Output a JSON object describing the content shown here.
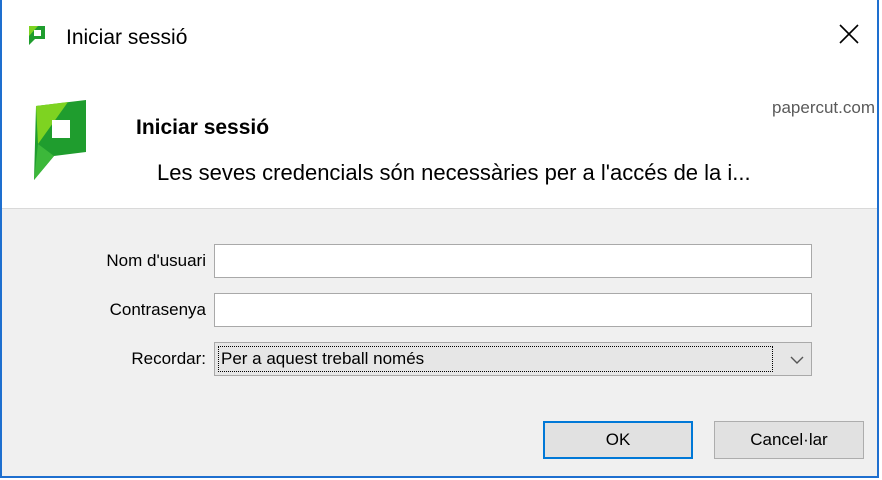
{
  "window": {
    "title": "Iniciar sessió",
    "icon": "papercut-logo-icon",
    "close_icon": "close-icon"
  },
  "header": {
    "title": "Iniciar sessió",
    "domain": "papercut.com",
    "message": "Les seves credencials són necessàries per a l'accés de la i..."
  },
  "form": {
    "username_label": "Nom d'usuari",
    "username_value": "",
    "password_label": "Contrasenya",
    "password_value": "",
    "remember_label": "Recordar:",
    "remember_selected": "Per a aquest treball només"
  },
  "buttons": {
    "ok_label": "OK",
    "cancel_label": "Cancel·lar"
  },
  "colors": {
    "accent": "#0078d7",
    "logo_green_dark": "#1f9d2e",
    "logo_green_light": "#7ed321",
    "form_background": "#f0f0f0"
  }
}
